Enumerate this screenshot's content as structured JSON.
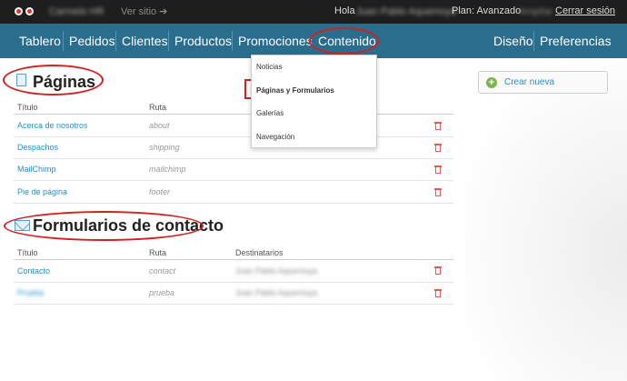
{
  "topbar": {
    "store_name": "Carmelo HR",
    "view_site": "Ver sitio ➔",
    "greeting": "Hola",
    "user_name": "Juan Pablo Aquemoya",
    "plan": "Plan: Avanzado",
    "plan_extra": "Ampliar",
    "logout": "Cerrar sesión"
  },
  "nav": {
    "items": [
      "Tablero",
      "Pedidos",
      "Clientes",
      "Productos",
      "Promociones",
      "Contenido"
    ],
    "right_items": [
      "Diseño",
      "Preferencias"
    ]
  },
  "dropdown": {
    "items": [
      "Noticias",
      "Páginas y Formularios",
      "Galerías",
      "Navegación"
    ]
  },
  "pages": {
    "title": "Páginas",
    "headers": [
      "Título",
      "Ruta"
    ],
    "rows": [
      {
        "title": "Acerca de nosotros",
        "route": "about"
      },
      {
        "title": "Despachos",
        "route": "shipping"
      },
      {
        "title": "MailChimp",
        "route": "mailchimp"
      },
      {
        "title": "Pie de página",
        "route": "footer"
      }
    ]
  },
  "forms": {
    "title": "Formularios de contacto",
    "headers": [
      "Título",
      "Ruta",
      "Destinatarios"
    ],
    "rows": [
      {
        "title": "Contacto",
        "route": "contact",
        "recipients": "Juan Pablo Aquemoya"
      },
      {
        "title": "Prueba",
        "route": "prueba",
        "recipients": "Juan Pablo Aquemoya"
      }
    ]
  },
  "sidebar": {
    "new_button": "Crear nueva"
  },
  "colors": {
    "nav_bg": "#2b6d8c",
    "topbar_bg": "#1e1e1e",
    "link": "#2a8ec6",
    "annotation": "#d32020",
    "delete": "#e55555"
  }
}
